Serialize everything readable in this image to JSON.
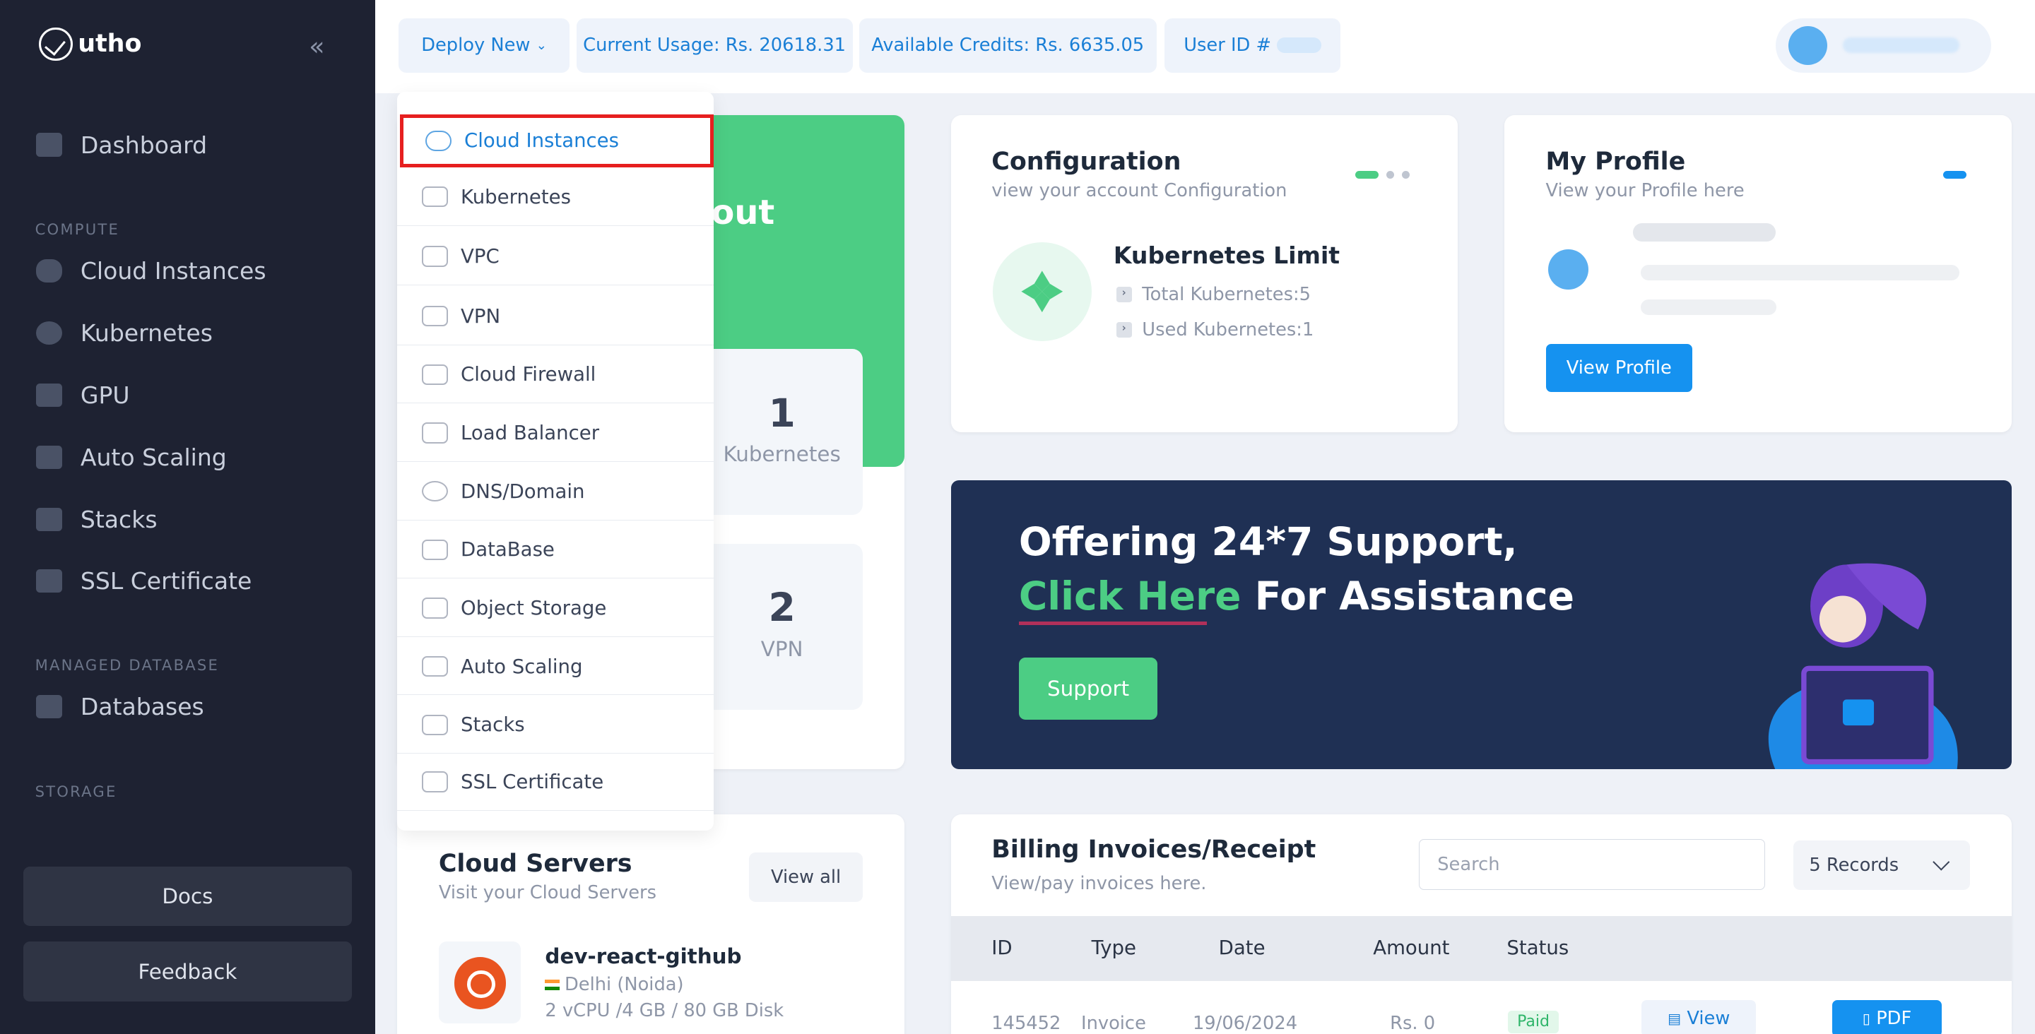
{
  "brand": {
    "name": "utho"
  },
  "sidebar": {
    "items": [
      {
        "label": "Dashboard"
      },
      {
        "label": "Cloud Instances"
      },
      {
        "label": "Kubernetes"
      },
      {
        "label": "GPU"
      },
      {
        "label": "Auto Scaling"
      },
      {
        "label": "Stacks"
      },
      {
        "label": "SSL Certificate"
      },
      {
        "label": "Databases"
      }
    ],
    "sections": [
      "COMPUTE",
      "MANAGED DATABASE",
      "STORAGE"
    ],
    "docs": "Docs",
    "feedback": "Feedback"
  },
  "topbar": {
    "deploy_new": "Deploy New",
    "current_usage": "Current Usage: Rs. 20618.31",
    "available_credits": "Available Credits: Rs. 6635.05",
    "user_id": "User ID #"
  },
  "deploy_menu": [
    {
      "label": "Cloud Instances",
      "icon": "cloud-icon"
    },
    {
      "label": "Kubernetes",
      "icon": "binoculars-icon"
    },
    {
      "label": "VPC",
      "icon": "share-icon"
    },
    {
      "label": "VPN",
      "icon": "lock-icon"
    },
    {
      "label": "Cloud Firewall",
      "icon": "fire-icon"
    },
    {
      "label": "Load Balancer",
      "icon": "hierarchy-icon"
    },
    {
      "label": "DNS/Domain",
      "icon": "globe-icon"
    },
    {
      "label": "DataBase",
      "icon": "database-icon"
    },
    {
      "label": "Object Storage",
      "icon": "storage-icon"
    },
    {
      "label": "Auto Scaling",
      "icon": "rocket-icon"
    },
    {
      "label": "Stacks",
      "icon": "stacks-icon"
    },
    {
      "label": "SSL Certificate",
      "icon": "shield-icon"
    }
  ],
  "welcome": {
    "partial": "out"
  },
  "stats": [
    {
      "value": "1",
      "label": "Kubernetes"
    },
    {
      "value": "2",
      "label": "VPN"
    }
  ],
  "configuration": {
    "title": "Configuration",
    "subtitle": "view your account Configuration",
    "limit_title": "Kubernetes Limit",
    "total": "Total Kubernetes:5",
    "used": "Used Kubernetes:1"
  },
  "profile": {
    "title": "My Profile",
    "subtitle": "View your Profile here",
    "button": "View Profile"
  },
  "banner": {
    "line1": "Offering 24*7 Support,",
    "click": "Click Here",
    "line2_rest": " For Assistance",
    "button": "Support"
  },
  "cloud_servers": {
    "title": "Cloud Servers",
    "subtitle": "Visit your Cloud Servers",
    "view_all": "View all",
    "server": {
      "name": "dev-react-github",
      "location": "Delhi (Noida)",
      "specs": "2 vCPU /4 GB / 80 GB Disk"
    }
  },
  "billing": {
    "title": "Billing Invoices/Receipt",
    "subtitle": "View/pay invoices here.",
    "search_placeholder": "Search",
    "records": "5 Records",
    "columns": [
      "ID",
      "Type",
      "Date",
      "Amount",
      "Status"
    ],
    "row": {
      "id": "145452",
      "type": "Invoice",
      "date": "19/06/2024",
      "amount": "Rs. 0",
      "status": "Paid",
      "view": "View",
      "pdf": "PDF"
    }
  },
  "colors": {
    "accent": "#1592f0",
    "green": "#4ccd84",
    "sidebar": "#1e2232",
    "highlight": "#e61f1f"
  }
}
